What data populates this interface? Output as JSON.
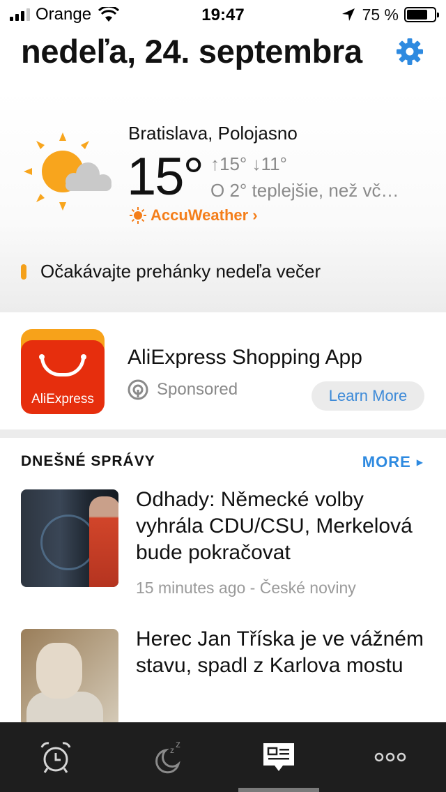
{
  "status_bar": {
    "carrier": "Orange",
    "time": "19:47",
    "battery_percent": "75 %",
    "battery_level": 0.75,
    "signal_bars": 3,
    "signal_bars_total": 4
  },
  "header": {
    "date": "nedeľa, 24. septembra",
    "settings_icon": "gear-icon",
    "accent_color": "#2e8ae0"
  },
  "weather": {
    "location_condition": "Bratislava, Polojasno",
    "temperature": "15°",
    "high_low": "↑15° ↓11°",
    "comparison": "O 2° teplejšie, než vč…",
    "provider": "AccuWeather",
    "provider_chevron": "›",
    "provider_color": "#f47e1a",
    "forecast": "Očakávajte prehánky nedeľa večer",
    "icon": "partly-sunny-icon"
  },
  "ad": {
    "title": "AliExpress Shopping App",
    "brand_logo_text": "AliExpress",
    "sponsored_label": "Sponsored",
    "cta_label": "Learn More"
  },
  "news": {
    "section_title": "DNEŠNÉ SPRÁVY",
    "more_label": "MORE",
    "articles": [
      {
        "headline": "Odhady: Německé volby vyhrála CDU/CSU, Merkelová bude pokračovat",
        "meta": "15 minutes ago - České noviny"
      },
      {
        "headline": "Herec Jan Tříska je ve vážném stavu, spadl z Karlova mostu",
        "meta": ""
      }
    ]
  },
  "tab_bar": {
    "tabs": [
      "alarm-clock-icon",
      "sleep-moon-icon",
      "news-icon",
      "more-dots-icon"
    ],
    "active_tab": "news-icon"
  }
}
